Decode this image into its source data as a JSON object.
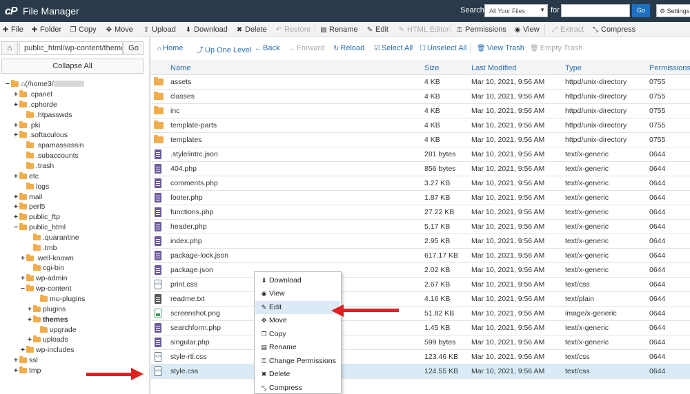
{
  "header": {
    "logo": "cP",
    "title": "File Manager",
    "search_label": "Search",
    "search_scope": "All Your Files",
    "for_label": "for",
    "search_value": "",
    "go_label": "Go",
    "settings_label": "Settings"
  },
  "toolbar": {
    "file": "File",
    "folder": "Folder",
    "copy": "Copy",
    "move": "Move",
    "upload": "Upload",
    "download": "Download",
    "delete": "Delete",
    "restore": "Restore",
    "rename": "Rename",
    "edit": "Edit",
    "html_editor": "HTML Editor",
    "permissions": "Permissions",
    "view": "View",
    "extract": "Extract",
    "compress": "Compress"
  },
  "left_panel": {
    "path_value": "public_html/wp-content/themes",
    "go_label": "Go",
    "collapse_label": "Collapse All",
    "root_label": "(/home3/",
    "tree": [
      {
        "label": ".cpanel",
        "exp": "+"
      },
      {
        "label": ".cphorde",
        "exp": "+"
      },
      {
        "label": ".htpasswds",
        "exp": ""
      },
      {
        "label": ".pki",
        "exp": "+"
      },
      {
        "label": ".softaculous",
        "exp": "+"
      },
      {
        "label": ".spamassassin",
        "exp": ""
      },
      {
        "label": ".subaccounts",
        "exp": ""
      },
      {
        "label": ".trash",
        "exp": ""
      },
      {
        "label": "etc",
        "exp": "+"
      },
      {
        "label": "logs",
        "exp": ""
      },
      {
        "label": "mail",
        "exp": "+"
      },
      {
        "label": "perl5",
        "exp": "+"
      },
      {
        "label": "public_ftp",
        "exp": "+"
      },
      {
        "label": "public_html",
        "exp": "−"
      },
      {
        "label": ".quarantine",
        "exp": ""
      },
      {
        "label": ".tmb",
        "exp": ""
      },
      {
        "label": ".well-known",
        "exp": "+"
      },
      {
        "label": "cgi-bin",
        "exp": ""
      },
      {
        "label": "wp-admin",
        "exp": "+"
      },
      {
        "label": "wp-content",
        "exp": "−"
      },
      {
        "label": "mu-plugins",
        "exp": ""
      },
      {
        "label": "plugins",
        "exp": "+"
      },
      {
        "label": "themes",
        "exp": "+"
      },
      {
        "label": "upgrade",
        "exp": ""
      },
      {
        "label": "uploads",
        "exp": "+"
      },
      {
        "label": "wp-includes",
        "exp": "+"
      },
      {
        "label": "ssl",
        "exp": "+"
      },
      {
        "label": "tmp",
        "exp": "+"
      }
    ]
  },
  "navbar": {
    "home": "Home",
    "up_one_level": "Up One Level",
    "back": "Back",
    "forward": "Forward",
    "reload": "Reload",
    "select_all": "Select All",
    "unselect_all": "Unselect All",
    "view_trash": "View Trash",
    "empty_trash": "Empty Trash"
  },
  "table": {
    "columns": [
      "Name",
      "Size",
      "Last Modified",
      "Type",
      "Permissions"
    ],
    "rows": [
      {
        "name": "assets",
        "size": "4 KB",
        "modified": "Mar 10, 2021, 9:56 AM",
        "type": "httpd/unix-directory",
        "perm": "0755",
        "icon": "folder"
      },
      {
        "name": "classes",
        "size": "4 KB",
        "modified": "Mar 10, 2021, 9:56 AM",
        "type": "httpd/unix-directory",
        "perm": "0755",
        "icon": "folder"
      },
      {
        "name": "inc",
        "size": "4 KB",
        "modified": "Mar 10, 2021, 9:56 AM",
        "type": "httpd/unix-directory",
        "perm": "0755",
        "icon": "folder"
      },
      {
        "name": "template-parts",
        "size": "4 KB",
        "modified": "Mar 10, 2021, 9:56 AM",
        "type": "httpd/unix-directory",
        "perm": "0755",
        "icon": "folder"
      },
      {
        "name": "templates",
        "size": "4 KB",
        "modified": "Mar 10, 2021, 9:56 AM",
        "type": "httpd/unix-directory",
        "perm": "0755",
        "icon": "folder"
      },
      {
        "name": ".stylelintrc.json",
        "size": "281 bytes",
        "modified": "Mar 10, 2021, 9:56 AM",
        "type": "text/x-generic",
        "perm": "0644",
        "icon": "file"
      },
      {
        "name": "404.php",
        "size": "856 bytes",
        "modified": "Mar 10, 2021, 9:56 AM",
        "type": "text/x-generic",
        "perm": "0644",
        "icon": "file"
      },
      {
        "name": "comments.php",
        "size": "3.27 KB",
        "modified": "Mar 10, 2021, 9:56 AM",
        "type": "text/x-generic",
        "perm": "0644",
        "icon": "file"
      },
      {
        "name": "footer.php",
        "size": "1.87 KB",
        "modified": "Mar 10, 2021, 9:56 AM",
        "type": "text/x-generic",
        "perm": "0644",
        "icon": "file"
      },
      {
        "name": "functions.php",
        "size": "27.22 KB",
        "modified": "Mar 10, 2021, 9:56 AM",
        "type": "text/x-generic",
        "perm": "0644",
        "icon": "file"
      },
      {
        "name": "header.php",
        "size": "5.17 KB",
        "modified": "Mar 10, 2021, 9:56 AM",
        "type": "text/x-generic",
        "perm": "0644",
        "icon": "file"
      },
      {
        "name": "index.php",
        "size": "2.95 KB",
        "modified": "Mar 10, 2021, 9:56 AM",
        "type": "text/x-generic",
        "perm": "0644",
        "icon": "file"
      },
      {
        "name": "package-lock.json",
        "size": "617.17 KB",
        "modified": "Mar 10, 2021, 9:56 AM",
        "type": "text/x-generic",
        "perm": "0644",
        "icon": "file"
      },
      {
        "name": "package.json",
        "size": "2.02 KB",
        "modified": "Mar 10, 2021, 9:56 AM",
        "type": "text/x-generic",
        "perm": "0644",
        "icon": "file"
      },
      {
        "name": "print.css",
        "size": "2.67 KB",
        "modified": "Mar 10, 2021, 9:56 AM",
        "type": "text/css",
        "perm": "0644",
        "icon": "code"
      },
      {
        "name": "readme.txt",
        "size": "4.16 KB",
        "modified": "Mar 10, 2021, 9:56 AM",
        "type": "text/plain",
        "perm": "0644",
        "icon": "text"
      },
      {
        "name": "screenshot.png",
        "size": "51.82 KB",
        "modified": "Mar 10, 2021, 9:56 AM",
        "type": "image/x-generic",
        "perm": "0644",
        "icon": "image"
      },
      {
        "name": "searchform.php",
        "size": "1.45 KB",
        "modified": "Mar 10, 2021, 9:56 AM",
        "type": "text/x-generic",
        "perm": "0644",
        "icon": "file"
      },
      {
        "name": "singular.php",
        "size": "599 bytes",
        "modified": "Mar 10, 2021, 9:56 AM",
        "type": "text/x-generic",
        "perm": "0644",
        "icon": "file"
      },
      {
        "name": "style-rtl.css",
        "size": "123.46 KB",
        "modified": "Mar 10, 2021, 9:56 AM",
        "type": "text/css",
        "perm": "0644",
        "icon": "code"
      },
      {
        "name": "style.css",
        "size": "124.55 KB",
        "modified": "Mar 10, 2021, 9:56 AM",
        "type": "text/css",
        "perm": "0644",
        "icon": "code",
        "selected": true
      }
    ]
  },
  "context_menu": {
    "items": [
      "Download",
      "View",
      "Edit",
      "Move",
      "Copy",
      "Rename",
      "Change Permissions",
      "Delete",
      "Compress"
    ],
    "highlighted": "Edit"
  },
  "colors": {
    "header_bg": "#293a4a",
    "accent": "#2a6db0",
    "folder": "#f0ad4e",
    "arrow": "#e02020",
    "selected_row": "#d9ebf7"
  }
}
